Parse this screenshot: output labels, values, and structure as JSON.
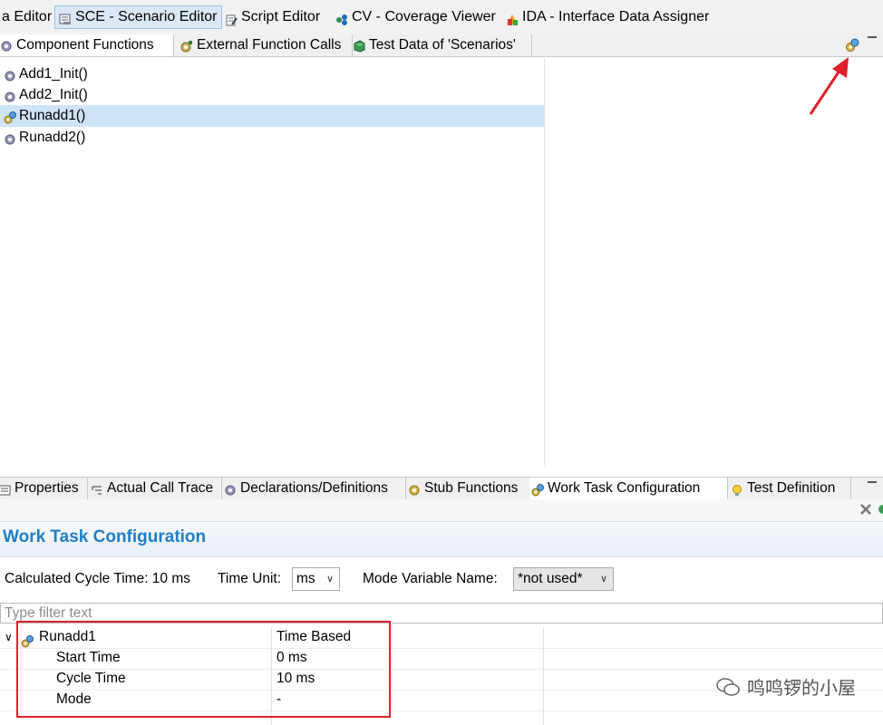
{
  "perspectives": [
    {
      "label": "a Editor",
      "active": false,
      "icon": "editor-icon"
    },
    {
      "label": "SCE - Scenario Editor",
      "active": true,
      "icon": "scenario-editor-icon"
    },
    {
      "label": "Script Editor",
      "active": false,
      "icon": "script-editor-icon"
    },
    {
      "label": "CV - Coverage Viewer",
      "active": false,
      "icon": "coverage-viewer-icon"
    },
    {
      "label": "IDA - Interface Data Assigner",
      "active": false,
      "icon": "interface-data-assigner-icon"
    }
  ],
  "top_tabs": [
    {
      "label": "Component Functions",
      "active": true
    },
    {
      "label": "External Function Calls",
      "active": false
    },
    {
      "label": "Test Data of 'Scenarios'",
      "active": false
    }
  ],
  "functions": [
    {
      "label": "Add1_Init()",
      "selected": false,
      "icon": "gear-icon"
    },
    {
      "label": "Add2_Init()",
      "selected": false,
      "icon": "gear-icon"
    },
    {
      "label": "Runadd1()",
      "selected": true,
      "icon": "work-task-icon"
    },
    {
      "label": "Runadd2()",
      "selected": false,
      "icon": "gear-icon"
    }
  ],
  "bottom_tabs": [
    {
      "label": "Properties",
      "active": false
    },
    {
      "label": "Actual Call Trace",
      "active": false
    },
    {
      "label": "Declarations/Definitions",
      "active": false
    },
    {
      "label": "Stub Functions",
      "active": false
    },
    {
      "label": "Work Task Configuration",
      "active": true
    },
    {
      "label": "Test Definition",
      "active": false
    }
  ],
  "panel": {
    "title": "Work Task Configuration",
    "calculated_cycle_time": "Calculated Cycle Time: 10 ms",
    "time_unit_label": "Time Unit:",
    "time_unit_value": "ms",
    "mode_variable_label": "Mode Variable Name:",
    "mode_variable_value": "*not used*",
    "filter_placeholder": "Type filter text"
  },
  "task_table": {
    "task_name": "Runadd1",
    "task_type": "Time Based",
    "rows": [
      {
        "name": "Start Time",
        "value": "0 ms"
      },
      {
        "name": "Cycle Time",
        "value": "10 ms"
      },
      {
        "name": "Mode",
        "value": "-"
      }
    ]
  },
  "watermark": "鸣鸣锣的小屋",
  "colors": {
    "accent": "#1f7fc4",
    "selection": "#cfe3f7",
    "highlight_box": "#e0212d",
    "annotation_arrow": "#e0212d"
  }
}
